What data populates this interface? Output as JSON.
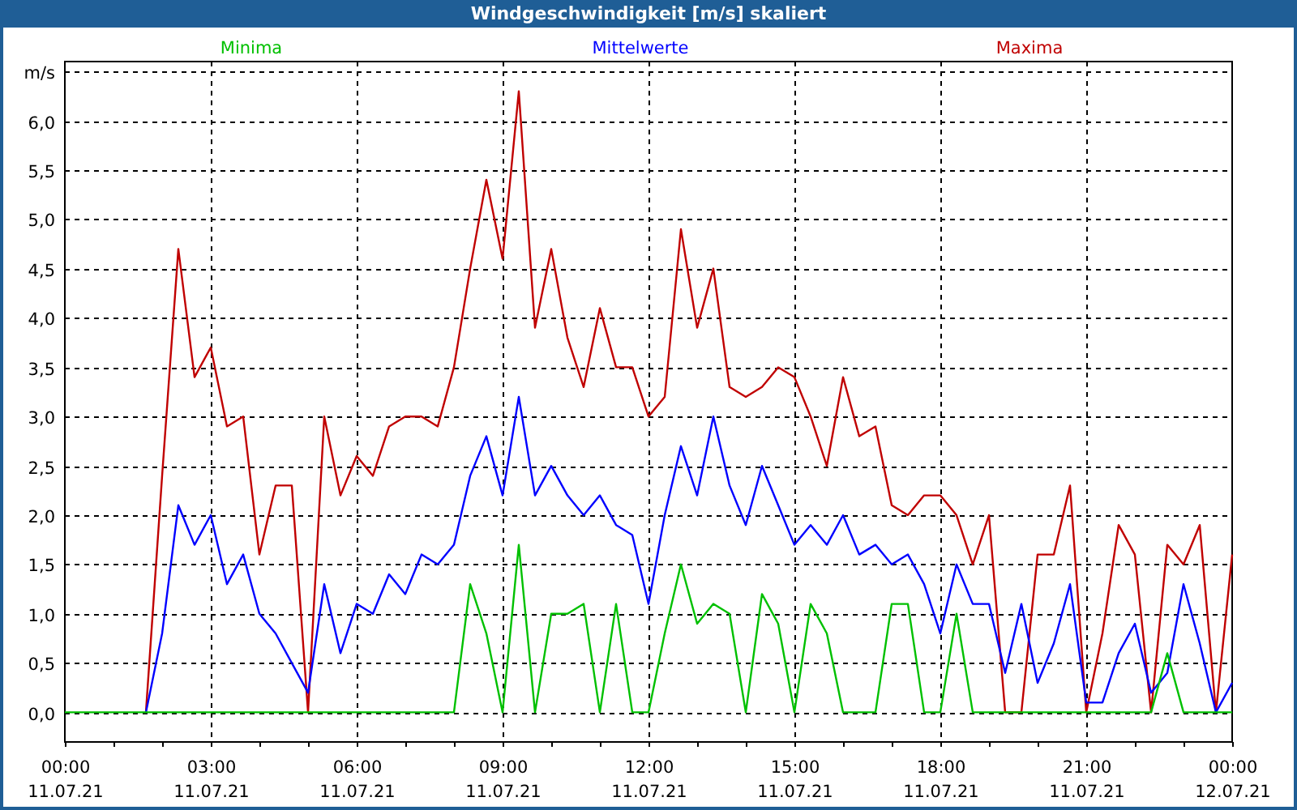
{
  "window": {
    "title": "Windgeschwindigkeit [m/s] skaliert"
  },
  "chart": {
    "chart_data": {
      "type": "line",
      "categories": [
        "00:00\n11.07.21",
        null,
        null,
        null,
        null,
        null,
        null,
        null,
        null,
        "03:00\n11.07.21",
        null,
        null,
        null,
        null,
        null,
        null,
        null,
        null,
        "06:00\n11.07.21",
        null,
        null,
        null,
        null,
        null,
        null,
        null,
        null,
        "09:00\n11.07.21",
        null,
        null,
        null,
        null,
        null,
        null,
        null,
        null,
        "12:00\n11.07.21",
        null,
        null,
        null,
        null,
        null,
        null,
        null,
        null,
        "15:00\n11.07.21",
        null,
        null,
        null,
        null,
        null,
        null,
        null,
        null,
        "18:00\n11.07.21",
        null,
        null,
        null,
        null,
        null,
        null,
        null,
        null,
        "21:00\n11.07.21",
        null,
        null,
        null,
        null,
        null,
        null,
        null,
        null,
        "00:00\n12.07.21"
      ],
      "series": [
        {
          "name": "Minima",
          "color": "#00c000",
          "values": [
            0,
            0,
            0,
            0,
            0,
            0,
            0,
            0,
            0,
            0,
            0,
            0,
            0,
            0,
            0,
            0,
            0,
            0,
            0,
            0,
            0,
            0,
            0,
            0,
            0,
            1.3,
            0.8,
            0,
            1.7,
            0,
            1.0,
            1.0,
            1.1,
            0,
            1.1,
            0,
            0,
            0.8,
            1.5,
            0.9,
            1.1,
            1.0,
            0,
            1.2,
            0.9,
            0,
            1.1,
            0.8,
            0,
            0,
            0,
            1.1,
            1.1,
            0,
            0,
            1.0,
            0,
            0,
            0,
            0,
            0,
            0,
            0,
            0,
            0,
            0,
            0,
            0,
            0.6,
            0,
            0,
            0,
            0
          ]
        },
        {
          "name": "Mittelwerte",
          "color": "#0000ff",
          "values": [
            null,
            null,
            null,
            null,
            null,
            0,
            0.8,
            2.1,
            1.7,
            2.0,
            1.3,
            1.6,
            1.0,
            0.8,
            0.5,
            0.2,
            1.3,
            0.6,
            1.1,
            1.0,
            1.4,
            1.2,
            1.6,
            1.5,
            1.7,
            2.4,
            2.8,
            2.2,
            3.2,
            2.2,
            2.5,
            2.2,
            2.0,
            2.2,
            1.9,
            1.8,
            1.1,
            2.0,
            2.7,
            2.2,
            3.0,
            2.3,
            1.9,
            2.5,
            2.1,
            1.7,
            1.9,
            1.7,
            2.0,
            1.6,
            1.7,
            1.5,
            1.6,
            1.3,
            0.8,
            1.5,
            1.1,
            1.1,
            0.4,
            1.1,
            0.3,
            0.7,
            1.3,
            0.1,
            0.1,
            0.6,
            0.9,
            0.2,
            0.4,
            1.3,
            0.7,
            0,
            0.3
          ]
        },
        {
          "name": "Maxima",
          "color": "#c00000",
          "values": [
            null,
            null,
            null,
            null,
            null,
            0,
            2.4,
            4.7,
            3.4,
            3.7,
            2.9,
            3.0,
            1.6,
            2.3,
            2.3,
            0,
            3.0,
            2.2,
            2.6,
            2.4,
            2.9,
            3.0,
            3.0,
            2.9,
            3.5,
            4.5,
            5.4,
            4.6,
            6.3,
            3.9,
            4.7,
            3.8,
            3.3,
            4.1,
            3.5,
            3.5,
            3.0,
            3.2,
            4.9,
            3.9,
            4.5,
            3.3,
            3.2,
            3.3,
            3.5,
            3.4,
            3.0,
            2.5,
            3.4,
            2.8,
            2.9,
            2.1,
            2.0,
            2.2,
            2.2,
            2.0,
            1.5,
            2.0,
            0,
            0,
            1.6,
            1.6,
            2.3,
            0,
            0.8,
            1.9,
            1.6,
            0,
            1.7,
            1.5,
            1.9,
            0,
            1.6
          ]
        }
      ],
      "ylim": [
        -0.3,
        6.6
      ],
      "grid": true,
      "yticks": [
        {
          "value": 0,
          "label": "0,0"
        },
        {
          "value": 0.5,
          "label": "0,5"
        },
        {
          "value": 1,
          "label": "1,0"
        },
        {
          "value": 1.5,
          "label": "1,5"
        },
        {
          "value": 2,
          "label": "2,0"
        },
        {
          "value": 2.5,
          "label": "2,5"
        },
        {
          "value": 3,
          "label": "3,0"
        },
        {
          "value": 3.5,
          "label": "3,5"
        },
        {
          "value": 4,
          "label": "4,0"
        },
        {
          "value": 4.5,
          "label": "4,5"
        },
        {
          "value": 5,
          "label": "5,0"
        },
        {
          "value": 5.5,
          "label": "5,5"
        },
        {
          "value": 6,
          "label": "6,0"
        },
        {
          "value": 6.5,
          "label": "m/s"
        }
      ]
    }
  }
}
